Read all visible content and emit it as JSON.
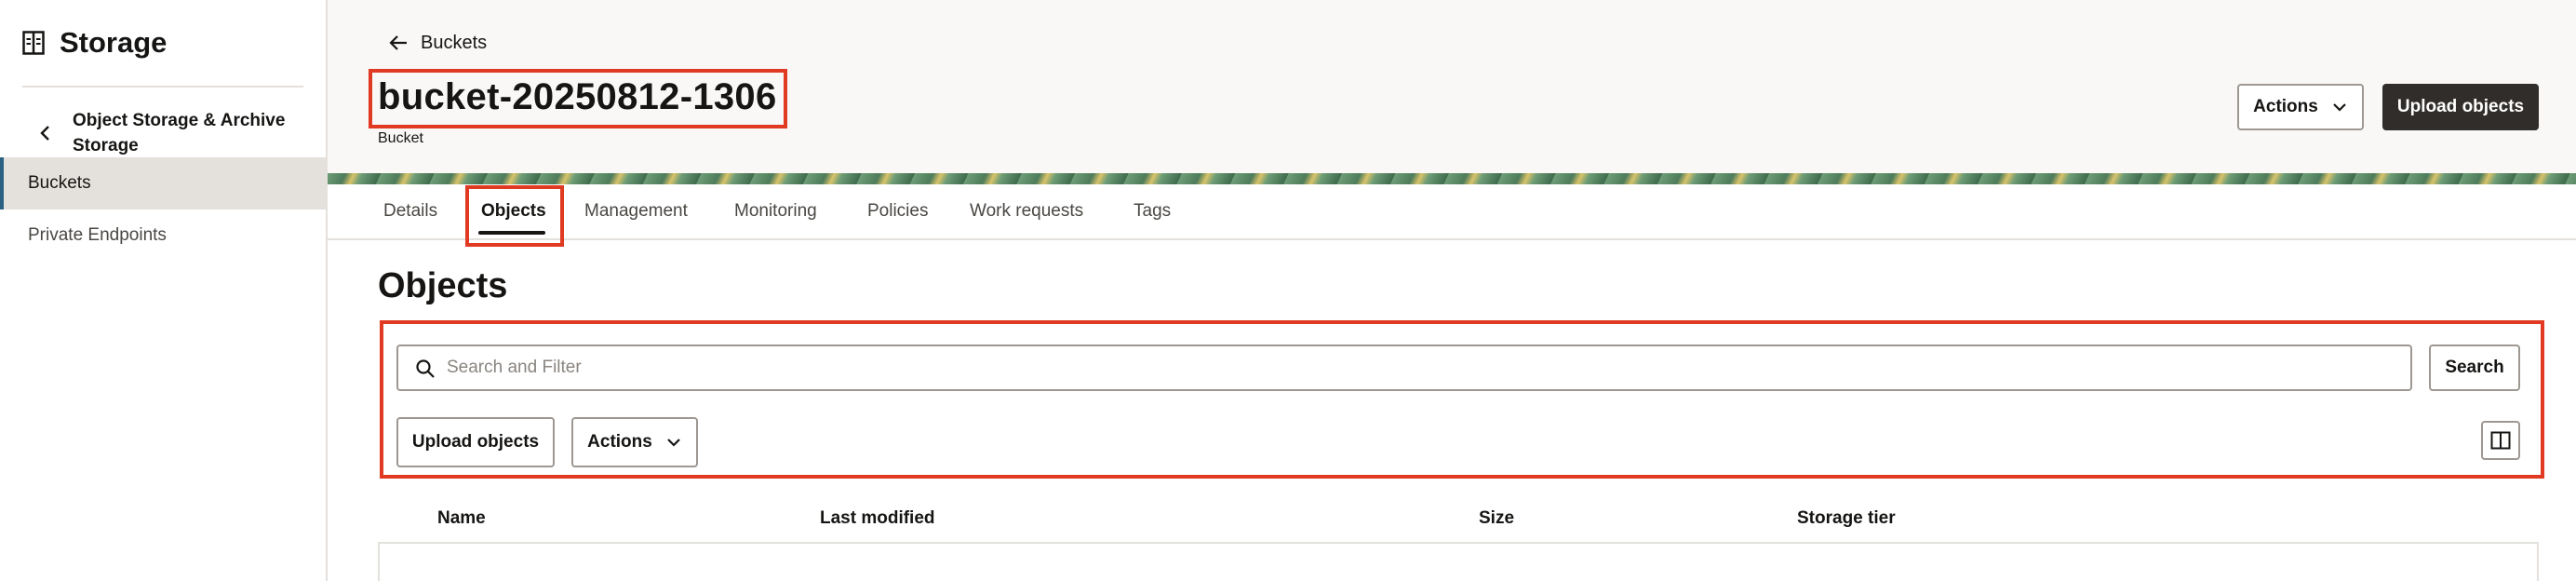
{
  "sidebar": {
    "title": "Storage",
    "section": "Object Storage & Archive Storage",
    "items": [
      {
        "label": "Buckets",
        "active": true
      },
      {
        "label": "Private Endpoints",
        "active": false
      }
    ]
  },
  "header": {
    "back_label": "Buckets",
    "bucket_name": "bucket-20250812-1306",
    "bucket_type": "Bucket",
    "actions_label": "Actions",
    "upload_label": "Upload objects"
  },
  "tabs": [
    {
      "label": "Details"
    },
    {
      "label": "Objects",
      "active": true
    },
    {
      "label": "Management"
    },
    {
      "label": "Monitoring"
    },
    {
      "label": "Policies"
    },
    {
      "label": "Work requests"
    },
    {
      "label": "Tags"
    }
  ],
  "objects": {
    "heading": "Objects",
    "search_placeholder": "Search and Filter",
    "search_button": "Search",
    "upload_button": "Upload objects",
    "actions_button": "Actions"
  },
  "table": {
    "columns": [
      "Name",
      "Last modified",
      "Size",
      "Storage tier"
    ]
  },
  "colors": {
    "highlight": "#e03a22",
    "accent": "#2b6182",
    "dark_button": "#312d2a"
  },
  "icons": [
    "storage-icon",
    "chevron-left-icon",
    "arrow-left-icon",
    "chevron-down-icon",
    "search-icon",
    "columns-icon"
  ]
}
